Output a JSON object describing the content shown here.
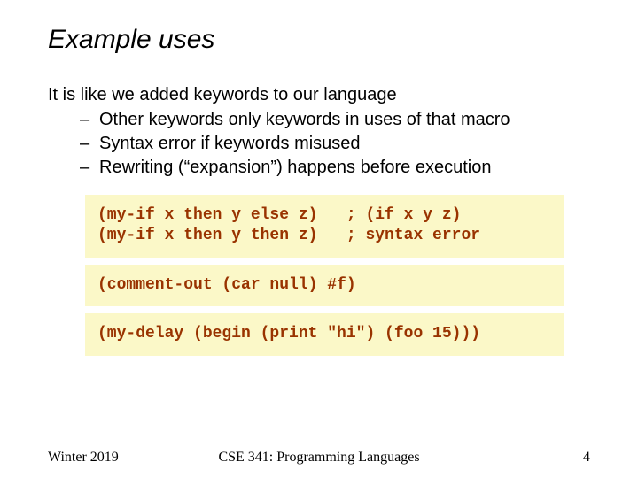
{
  "title": "Example uses",
  "lead": "It is like we added keywords to our language",
  "bullets": [
    "Other keywords only keywords in uses of that macro",
    "Syntax error if keywords misused",
    "Rewriting (“expansion”) happens before execution"
  ],
  "code": {
    "block1": "(my-if x then y else z)   ; (if x y z)\n(my-if x then y then z)   ; syntax error",
    "block2": "(comment-out (car null) #f)",
    "block3": "(my-delay (begin (print \"hi\") (foo 15)))"
  },
  "footer": {
    "left": "Winter 2019",
    "center": "CSE 341: Programming Languages",
    "right": "4"
  }
}
